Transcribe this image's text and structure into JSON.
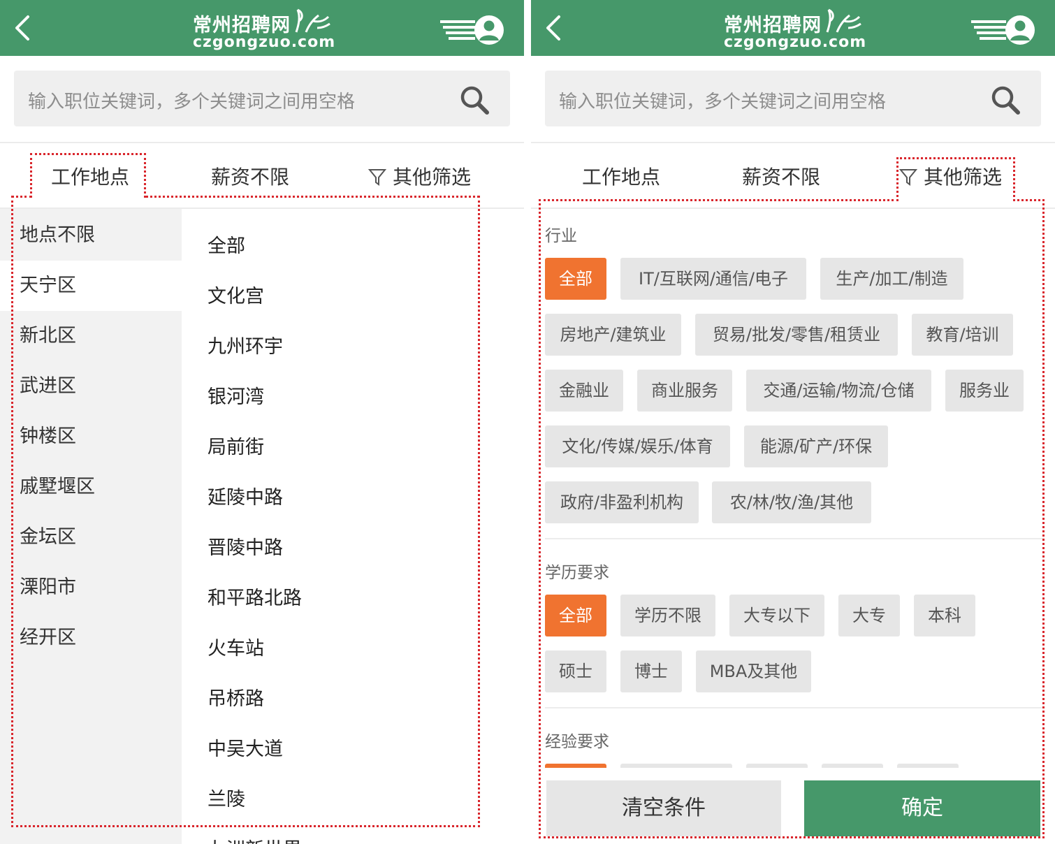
{
  "brand": {
    "name": "常州招聘网",
    "domain": "czgongzuo.com",
    "header_color": "#46986a"
  },
  "icons": {
    "back": "chevron-left-icon",
    "menu": "menu-lines-icon",
    "user": "user-avatar-icon",
    "search": "search-icon",
    "filter": "funnel-icon"
  },
  "search": {
    "placeholder": "输入职位关键词，多个关键词之间用空格"
  },
  "tabs": [
    {
      "label": "工作地点"
    },
    {
      "label": "薪资不限"
    },
    {
      "label": "其他筛选"
    }
  ],
  "location": {
    "districts": [
      {
        "label": "地点不限",
        "active": false
      },
      {
        "label": "天宁区",
        "active": true
      },
      {
        "label": "新北区",
        "active": false
      },
      {
        "label": "武进区",
        "active": false
      },
      {
        "label": "钟楼区",
        "active": false
      },
      {
        "label": "戚墅堰区",
        "active": false
      },
      {
        "label": "金坛区",
        "active": false
      },
      {
        "label": "溧阳市",
        "active": false
      },
      {
        "label": "经开区",
        "active": false
      }
    ],
    "areas": [
      "全部",
      "文化宫",
      "九州环宇",
      "银河湾",
      "局前街",
      "延陵中路",
      "晋陵中路",
      "和平路北路",
      "火车站",
      "吊桥路",
      "中吴大道",
      "兰陵",
      "九洲新世界"
    ]
  },
  "filters": {
    "industry": {
      "title": "行业",
      "options": [
        "全部",
        "IT/互联网/通信/电子",
        "生产/加工/制造",
        "房地产/建筑业",
        "贸易/批发/零售/租赁业",
        "教育/培训",
        "金融业",
        "商业服务",
        "交通/运输/物流/仓储",
        "服务业",
        "文化/传媒/娱乐/体育",
        "能源/矿产/环保",
        "政府/非盈利机构",
        "农/林/牧/渔/其他"
      ],
      "selected": "全部"
    },
    "education": {
      "title": "学历要求",
      "options": [
        "全部",
        "学历不限",
        "大专以下",
        "大专",
        "本科",
        "硕士",
        "博士",
        "MBA及其他"
      ],
      "selected": "全部"
    },
    "experience": {
      "title": "经验要求"
    }
  },
  "actions": {
    "clear_label": "清空条件",
    "confirm_label": "确定"
  },
  "colors": {
    "accent_orange": "#f07330",
    "highlight_dotted": "#d9262c"
  }
}
